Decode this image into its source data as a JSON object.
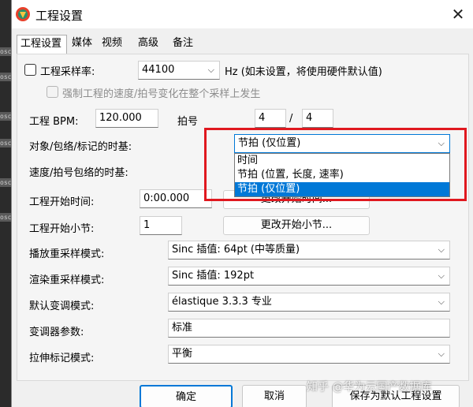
{
  "window": {
    "title": "工程设置",
    "close_glyph": "✕",
    "icon": "reaper-logo-icon"
  },
  "tabs": [
    {
      "label": "工程设置",
      "active": true
    },
    {
      "label": "媒体"
    },
    {
      "label": "视频"
    },
    {
      "label": "高级"
    },
    {
      "label": "备注"
    }
  ],
  "left_strip": {
    "text": "osc"
  },
  "sample_rate": {
    "label": "工程采样率:",
    "checked": false,
    "value": "44100",
    "note": "Hz (如未设置，将使用硬件默认值)"
  },
  "force_sample": {
    "label": "强制工程的速度/拍号变化在整个采样上发生",
    "checked": false
  },
  "bpm": {
    "label": "工程 BPM:",
    "value": "120.000"
  },
  "time_sig": {
    "label": "拍号",
    "numerator": "4",
    "separator": "/",
    "denominator": "4"
  },
  "timebase": {
    "label": "对象/包络/标记的时基:",
    "value": "节拍 (仅位置)"
  },
  "tempo_timebase": {
    "label": "速度/拍号包络的时基:"
  },
  "dropdown_options": [
    "时间",
    "节拍 (位置, 长度, 速率)",
    "节拍 (仅位置)"
  ],
  "start_time": {
    "label": "工程开始时间:",
    "value": "0:00.000",
    "button": "更改开始时间..."
  },
  "start_measure": {
    "label": "工程开始小节:",
    "value": "1",
    "button": "更改开始小节..."
  },
  "playback_resample": {
    "label": "播放重采样模式:",
    "value": "Sinc 插值: 64pt (中等质量)"
  },
  "render_resample": {
    "label": "渲染重采样模式:",
    "value": "Sinc 插值: 192pt"
  },
  "pitch_mode": {
    "label": "默认变调模式:",
    "value": "élastique 3.3.3 专业"
  },
  "shifter_params": {
    "label": "变调器参数:",
    "value": "标准"
  },
  "stretch_mode": {
    "label": "拉伸标记模式:",
    "value": "平衡"
  },
  "footer": {
    "ok": "确定",
    "cancel": "取消",
    "save_default": "保存为默认工程设置"
  },
  "watermark": "知乎 @华为云国产数据库",
  "colors": {
    "highlight": "#0078d7",
    "annotation_box": "#e0181f"
  }
}
